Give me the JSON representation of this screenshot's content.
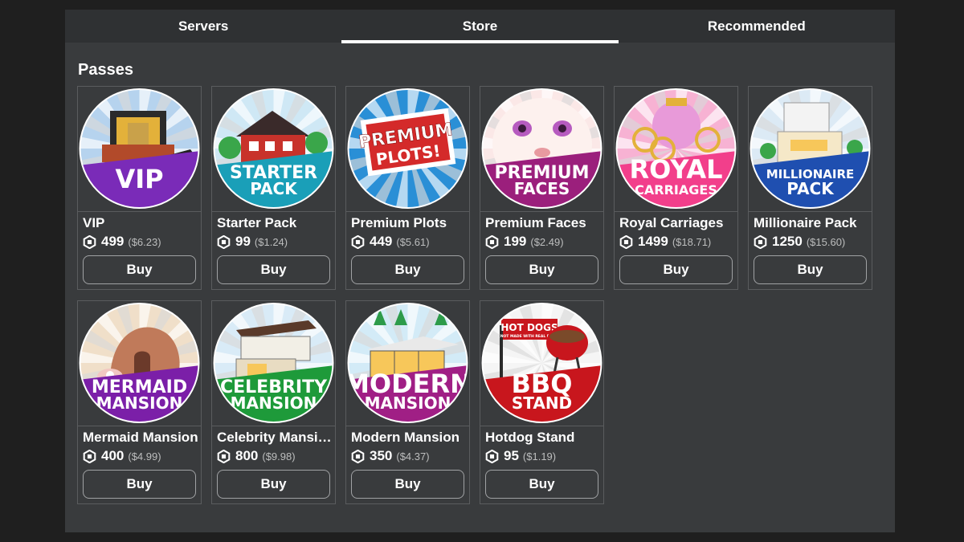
{
  "tabs": [
    {
      "label": "Servers",
      "active": false
    },
    {
      "label": "Store",
      "active": true
    },
    {
      "label": "Recommended",
      "active": false
    }
  ],
  "section_title": "Passes",
  "passes": [
    {
      "name": "VIP",
      "robux": "499",
      "usd": "($6.23)",
      "buy_label": "Buy",
      "art": {
        "line1": "VIP",
        "line2": "",
        "band": "#7a2bb8",
        "sky": "#b6d3ef",
        "icon": "vip-club-image"
      }
    },
    {
      "name": "Starter Pack",
      "robux": "99",
      "usd": "($1.24)",
      "buy_label": "Buy",
      "art": {
        "line1": "STARTER",
        "line2": "PACK",
        "band": "#1a9fb8",
        "sky": "#cfe9f5",
        "icon": "red-house-image"
      }
    },
    {
      "name": "Premium Plots",
      "robux": "449",
      "usd": "($5.61)",
      "buy_label": "Buy",
      "art": {
        "line1": "PREMIUM",
        "line2": "PLOTS!",
        "band": "#e8e8e8",
        "sky": "#2a8fd6",
        "icon": "premium-plots-sign-image"
      }
    },
    {
      "name": "Premium Faces",
      "robux": "199",
      "usd": "($2.49)",
      "buy_label": "Buy",
      "art": {
        "line1": "PREMIUM",
        "line2": "FACES",
        "band": "#9b1f7c",
        "sky": "#fbe9e7",
        "icon": "doll-face-image"
      }
    },
    {
      "name": "Royal Carriages",
      "robux": "1499",
      "usd": "($18.71)",
      "buy_label": "Buy",
      "art": {
        "line1": "ROYAL",
        "line2": "CARRIAGES",
        "band": "#f23f8b",
        "sky": "#f7b3d3",
        "icon": "pink-carriage-image"
      }
    },
    {
      "name": "Millionaire Pack",
      "robux": "1250",
      "usd": "($15.60)",
      "buy_label": "Buy",
      "art": {
        "line1": "MILLIONAIRE",
        "line2": "PACK",
        "band": "#1f4fb0",
        "sky": "#dceaf5",
        "icon": "mansion-image"
      }
    },
    {
      "name": "Mermaid Mansion",
      "robux": "400",
      "usd": "($4.99)",
      "buy_label": "Buy",
      "art": {
        "line1": "MERMAID",
        "line2": "MANSION",
        "band": "#7b1fa8",
        "sky": "#f0dfc9",
        "icon": "shell-house-image"
      }
    },
    {
      "name": "Celebrity Mansion",
      "robux": "800",
      "usd": "($9.98)",
      "buy_label": "Buy",
      "art": {
        "line1": "CELEBRITY",
        "line2": "MANSION",
        "band": "#1e9a3a",
        "sky": "#d9ecf7",
        "icon": "modern-villa-image"
      }
    },
    {
      "name": "Modern Mansion",
      "robux": "350",
      "usd": "($4.37)",
      "buy_label": "Buy",
      "art": {
        "line1": "MODERN",
        "line2": "MANSION",
        "band": "#a01f85",
        "sky": "#d3ebf7",
        "icon": "glass-house-image"
      }
    },
    {
      "name": "Hotdog Stand",
      "robux": "95",
      "usd": "($1.19)",
      "buy_label": "Buy",
      "art": {
        "line1": "BBQ",
        "line2": "STAND",
        "band": "#c8161d",
        "sky": "#f5f5f5",
        "icon": "bbq-grill-image",
        "sign_line1": "HOT DOGS",
        "sign_line2": "(NOT MADE WITH REAL DOGS)"
      }
    }
  ],
  "colors": {
    "page_bg": "#1f1f1f",
    "panel_bg": "#393b3d",
    "tab_bar_bg": "#2f3133",
    "card_border": "#5a5c5e",
    "price_usd": "#bdbebe"
  },
  "icons": {
    "currency": "robux-icon"
  }
}
